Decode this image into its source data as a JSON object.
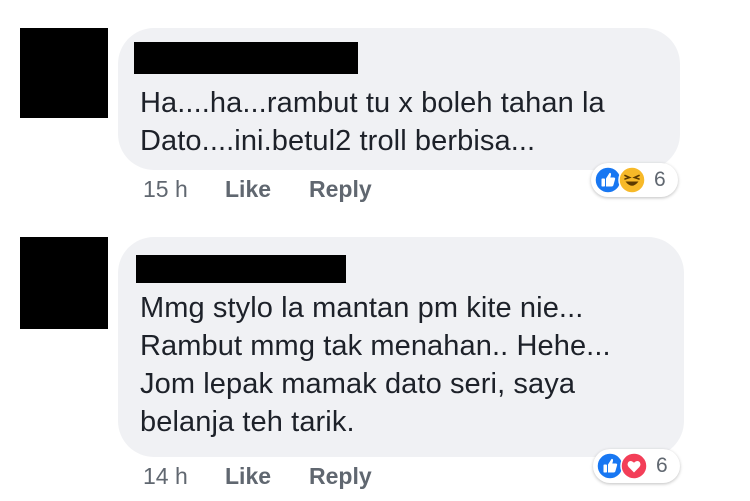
{
  "comments": [
    {
      "text_lines": [
        "Ha....ha...rambut tu x boleh tahan la",
        "Dato....ini.betul2 troll berbisa..."
      ],
      "time": "15 h",
      "like_label": "Like",
      "reply_label": "Reply",
      "reactions": {
        "icons": [
          "like-icon",
          "haha-icon"
        ],
        "count": "6"
      }
    },
    {
      "text_lines": [
        "Mmg stylo la mantan pm kite nie...",
        "Rambut mmg tak menahan.. Hehe...",
        "Jom lepak mamak dato seri, saya",
        "belanja teh tarik."
      ],
      "time": "14 h",
      "like_label": "Like",
      "reply_label": "Reply",
      "reactions": {
        "icons": [
          "like-icon",
          "love-icon"
        ],
        "count": "6"
      }
    }
  ],
  "colors": {
    "bubble": "#f0f1f4",
    "text": "#1d2129",
    "meta": "#606770",
    "like_blue": "#1877f2",
    "haha_yellow": "#f7b928",
    "love_red": "#f33e58",
    "redaction": "#000000"
  }
}
